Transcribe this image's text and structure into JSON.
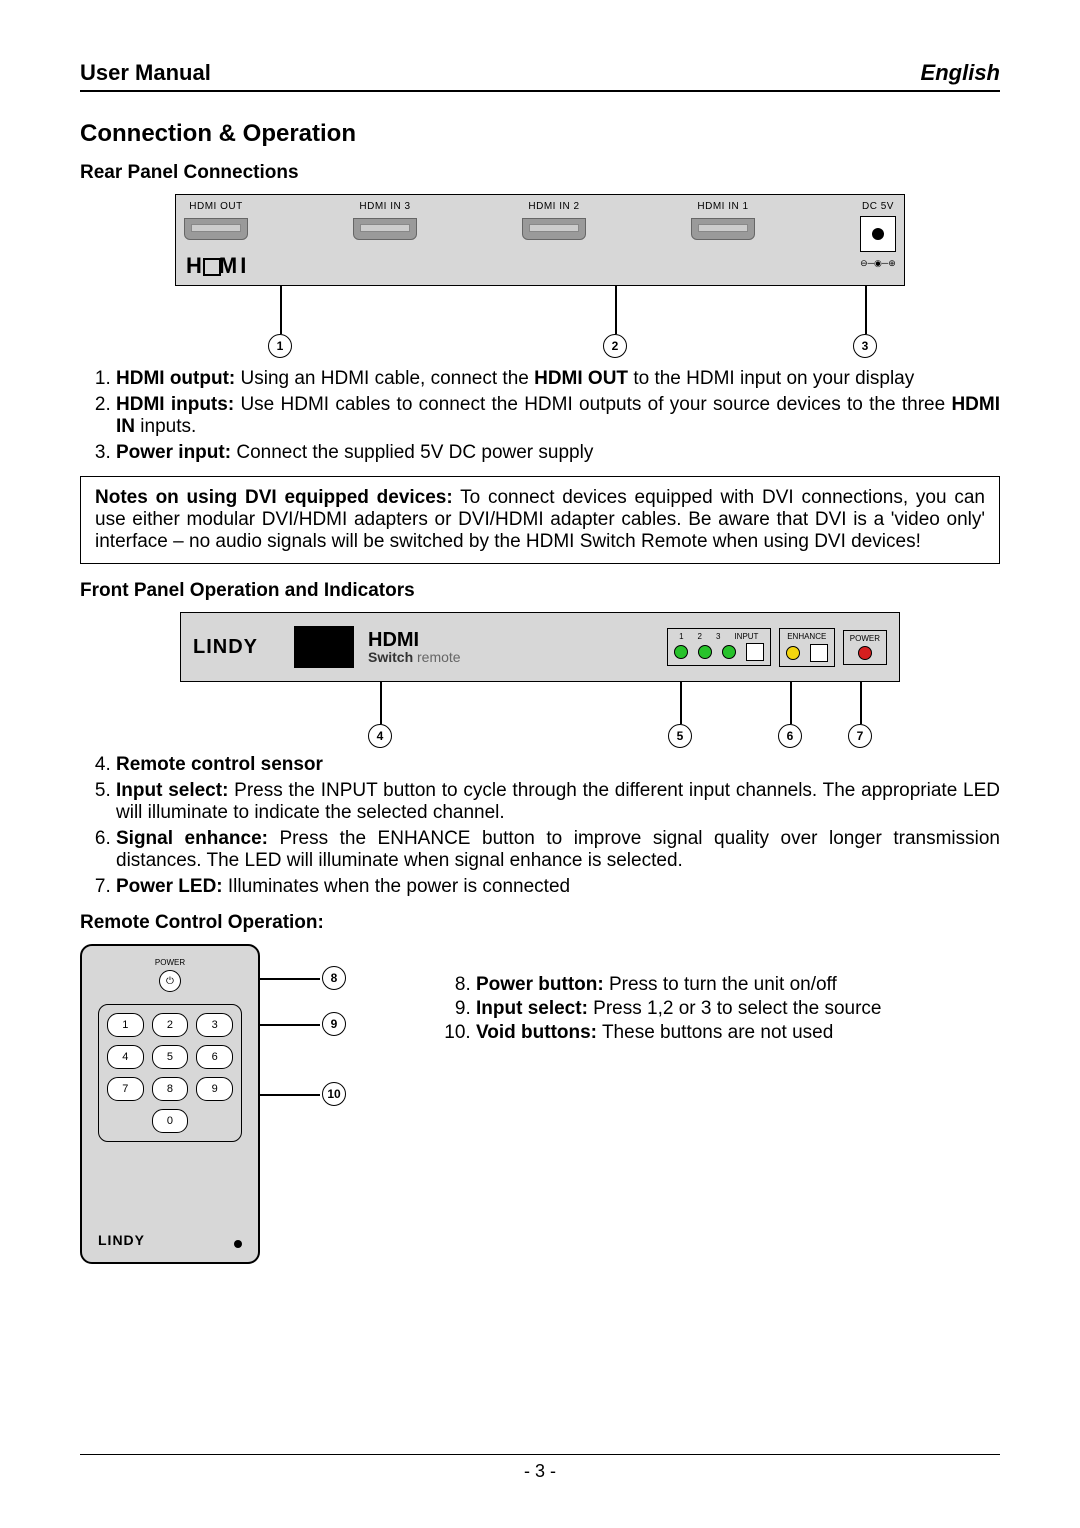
{
  "header": {
    "left": "User Manual",
    "right": "English"
  },
  "section_title": "Connection & Operation",
  "rear": {
    "heading": "Rear Panel Connections",
    "ports": {
      "out": "HDMI OUT",
      "in3": "HDMI IN 3",
      "in2": "HDMI IN 2",
      "in1": "HDMI IN 1",
      "dc": "DC 5V"
    },
    "logo": "HDMI",
    "callouts": {
      "c1": "1",
      "c2": "2",
      "c3": "3"
    },
    "items": [
      {
        "num": "1.",
        "lead": "HDMI output:",
        "text": " Using an HDMI cable, connect the ",
        "bold2": "HDMI OUT",
        "text2": " to the HDMI input on your display"
      },
      {
        "num": "2.",
        "lead": "HDMI inputs:",
        "text": " Use HDMI cables to connect the HDMI outputs of your source devices to the three ",
        "bold2": "HDMI IN",
        "text2": " inputs."
      },
      {
        "num": "3.",
        "lead": "Power input:",
        "text": " Connect the supplied 5V DC power supply",
        "bold2": "",
        "text2": ""
      }
    ]
  },
  "note": {
    "lead": "Notes on using DVI equipped devices:",
    "text": " To connect devices equipped with DVI connections, you can use either modular DVI/HDMI adapters or DVI/HDMI adapter cables. Be aware that DVI is a 'video only' interface – no audio signals will be switched by the HDMI Switch Remote when using DVI devices!"
  },
  "front": {
    "heading": "Front Panel Operation and Indicators",
    "brand": "LINDY",
    "title_l1": "HDMI",
    "title_l2a": "Switch",
    "title_l2b": "remote",
    "labels": {
      "n1": "1",
      "n2": "2",
      "n3": "3",
      "input": "INPUT",
      "enhance": "ENHANCE",
      "power": "POWER"
    },
    "callouts": {
      "c4": "4",
      "c5": "5",
      "c6": "6",
      "c7": "7"
    },
    "items": [
      {
        "num": "4.",
        "lead": "Remote control sensor",
        "text": ""
      },
      {
        "num": "5.",
        "lead": "Input select:",
        "text": " Press the INPUT button to cycle through the different input channels. The appropriate LED will illuminate to indicate the selected channel."
      },
      {
        "num": "6.",
        "lead": "Signal enhance:",
        "text": " Press the ENHANCE button to improve signal quality over longer transmission distances. The LED will illuminate when signal enhance is selected."
      },
      {
        "num": "7.",
        "lead": "Power LED:",
        "text": " Illuminates when the power is connected"
      }
    ]
  },
  "remote": {
    "heading": "Remote Control Operation:",
    "pwr_label": "POWER",
    "keys": {
      "k1": "1",
      "k2": "2",
      "k3": "3",
      "k4": "4",
      "k5": "5",
      "k6": "6",
      "k7": "7",
      "k8": "8",
      "k9": "9",
      "k0": "0"
    },
    "brand": "LINDY",
    "callouts": {
      "c8": "8",
      "c9": "9",
      "c10": "10"
    },
    "items": [
      {
        "num": "8.",
        "lead": "Power button:",
        "text": " Press to turn the unit on/off"
      },
      {
        "num": "9.",
        "lead": "Input select:",
        "text": " Press 1,2 or 3 to select the source"
      },
      {
        "num": "10.",
        "lead": "Void buttons:",
        "text": " These buttons are not used"
      }
    ]
  },
  "footer": "- 3 -"
}
